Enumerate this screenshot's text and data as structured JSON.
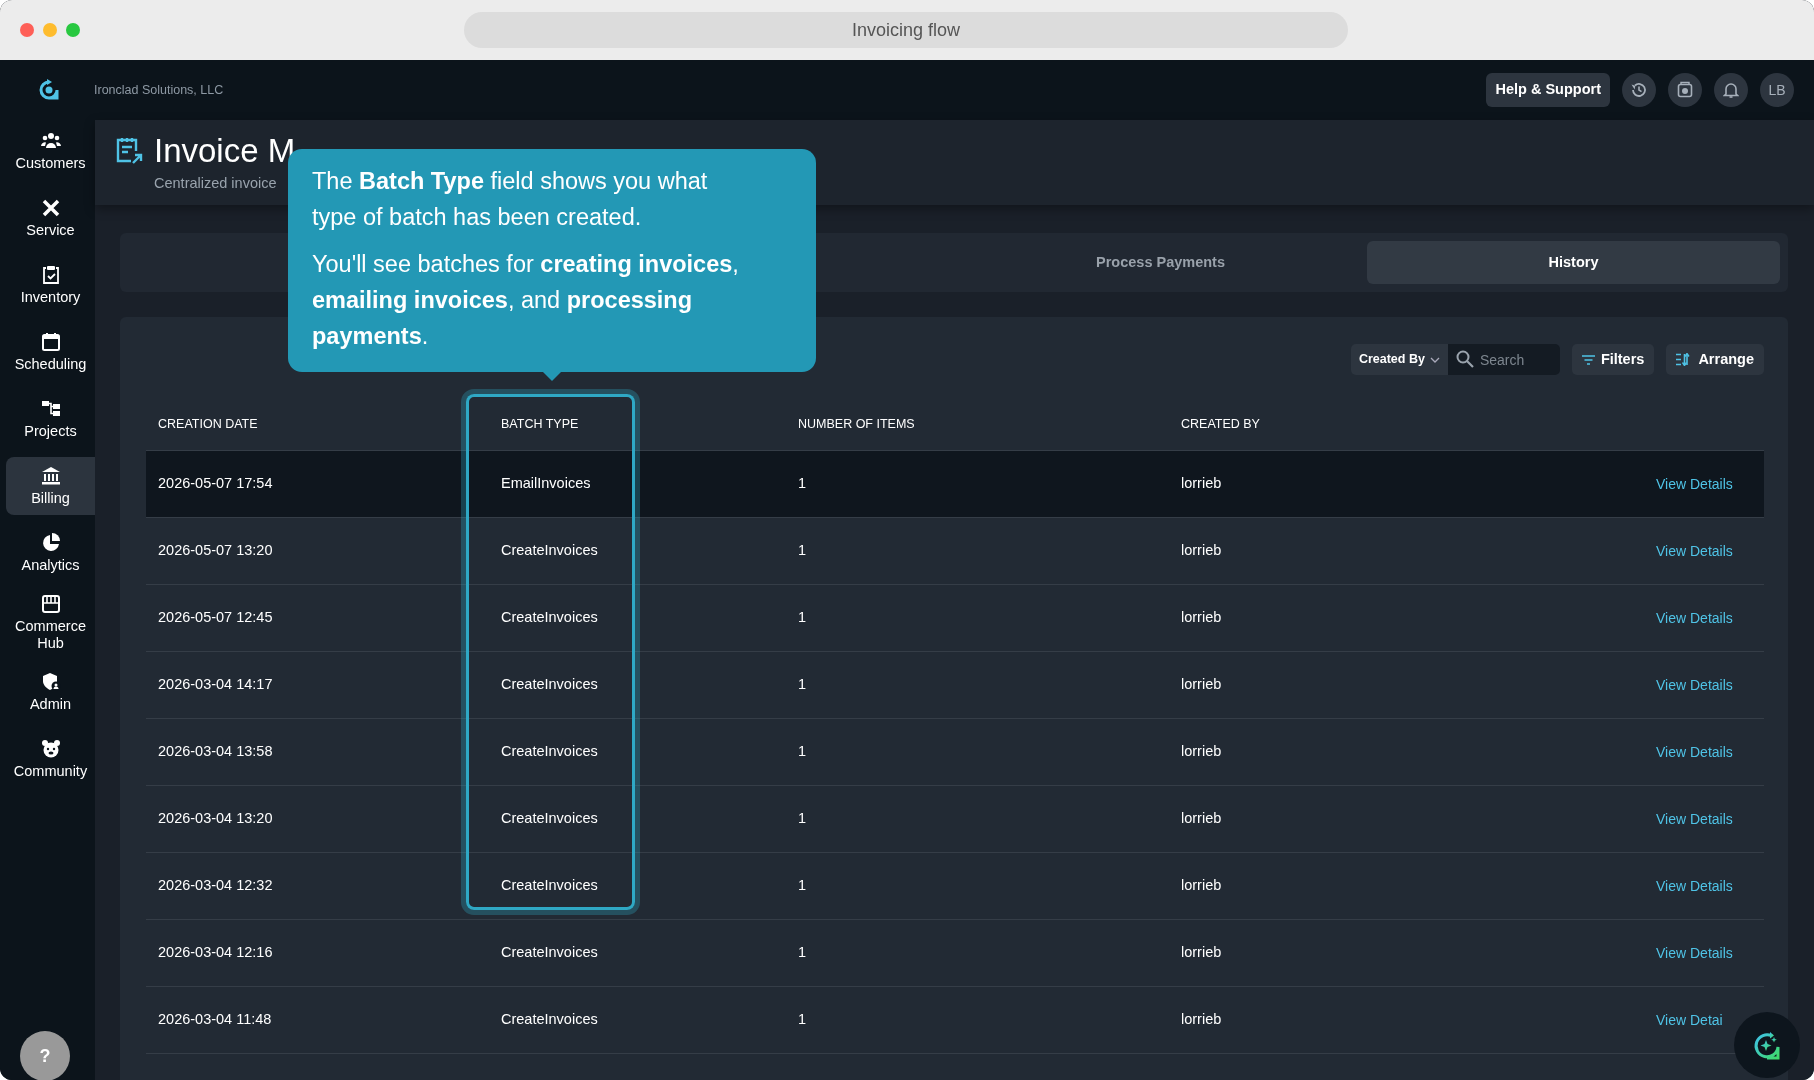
{
  "window": {
    "title": "Invoicing flow"
  },
  "topbar": {
    "company": "Ironclad Solutions, LLC",
    "help_button": "Help & Support",
    "avatar": "LB"
  },
  "sidebar": {
    "items": [
      {
        "label": "Customers",
        "selected": false
      },
      {
        "label": "Service",
        "selected": false
      },
      {
        "label": "Inventory",
        "selected": false
      },
      {
        "label": "Scheduling",
        "selected": false
      },
      {
        "label": "Projects",
        "selected": false
      },
      {
        "label": "Billing",
        "selected": true
      },
      {
        "label": "Analytics",
        "selected": false
      },
      {
        "label": "Commerce Hub",
        "selected": false
      },
      {
        "label": "Admin",
        "selected": false
      },
      {
        "label": "Community",
        "selected": false
      }
    ]
  },
  "page": {
    "title": "Invoice M",
    "subtitle": "Centralized invoice"
  },
  "tabs": [
    {
      "label": "Process Payments",
      "selected": false
    },
    {
      "label": "History",
      "selected": true
    }
  ],
  "toolbar": {
    "created_by": "Created By",
    "search": {
      "placeholder": "Search"
    },
    "filters": "Filters",
    "arrange": "Arrange"
  },
  "table": {
    "columns": [
      {
        "label": "CREATION DATE",
        "highlighted": false
      },
      {
        "label": "BATCH TYPE",
        "highlighted": true
      },
      {
        "label": "NUMBER OF ITEMS",
        "highlighted": false
      },
      {
        "label": "CREATED BY",
        "highlighted": false
      }
    ],
    "rows": [
      {
        "creation_date": "2026-05-07 17:54",
        "batch_type": "EmailInvoices",
        "number_of_items": "1",
        "created_by": "lorrieb",
        "action": "View Details",
        "highlighted": true
      },
      {
        "creation_date": "2026-05-07 13:20",
        "batch_type": "CreateInvoices",
        "number_of_items": "1",
        "created_by": "lorrieb",
        "action": "View Details",
        "highlighted": false
      },
      {
        "creation_date": "2026-05-07 12:45",
        "batch_type": "CreateInvoices",
        "number_of_items": "1",
        "created_by": "lorrieb",
        "action": "View Details",
        "highlighted": false
      },
      {
        "creation_date": "2026-03-04 14:17",
        "batch_type": "CreateInvoices",
        "number_of_items": "1",
        "created_by": "lorrieb",
        "action": "View Details",
        "highlighted": false
      },
      {
        "creation_date": "2026-03-04 13:58",
        "batch_type": "CreateInvoices",
        "number_of_items": "1",
        "created_by": "lorrieb",
        "action": "View Details",
        "highlighted": false
      },
      {
        "creation_date": "2026-03-04 13:20",
        "batch_type": "CreateInvoices",
        "number_of_items": "1",
        "created_by": "lorrieb",
        "action": "View Details",
        "highlighted": false
      },
      {
        "creation_date": "2026-03-04 12:32",
        "batch_type": "CreateInvoices",
        "number_of_items": "1",
        "created_by": "lorrieb",
        "action": "View Details",
        "highlighted": false
      },
      {
        "creation_date": "2026-03-04 12:16",
        "batch_type": "CreateInvoices",
        "number_of_items": "1",
        "created_by": "lorrieb",
        "action": "View Details",
        "highlighted": false
      },
      {
        "creation_date": "2026-03-04 11:48",
        "batch_type": "CreateInvoices",
        "number_of_items": "1",
        "created_by": "lorrieb",
        "action": "View Detai",
        "highlighted": false
      }
    ]
  },
  "tooltip": {
    "paragraphs": [
      "The **Batch Type** field shows you what type of batch has been created.",
      "You'll see batches for **creating invoices**, **emailing invoices**, and **processing payments**."
    ]
  },
  "help_bubble": "?"
}
